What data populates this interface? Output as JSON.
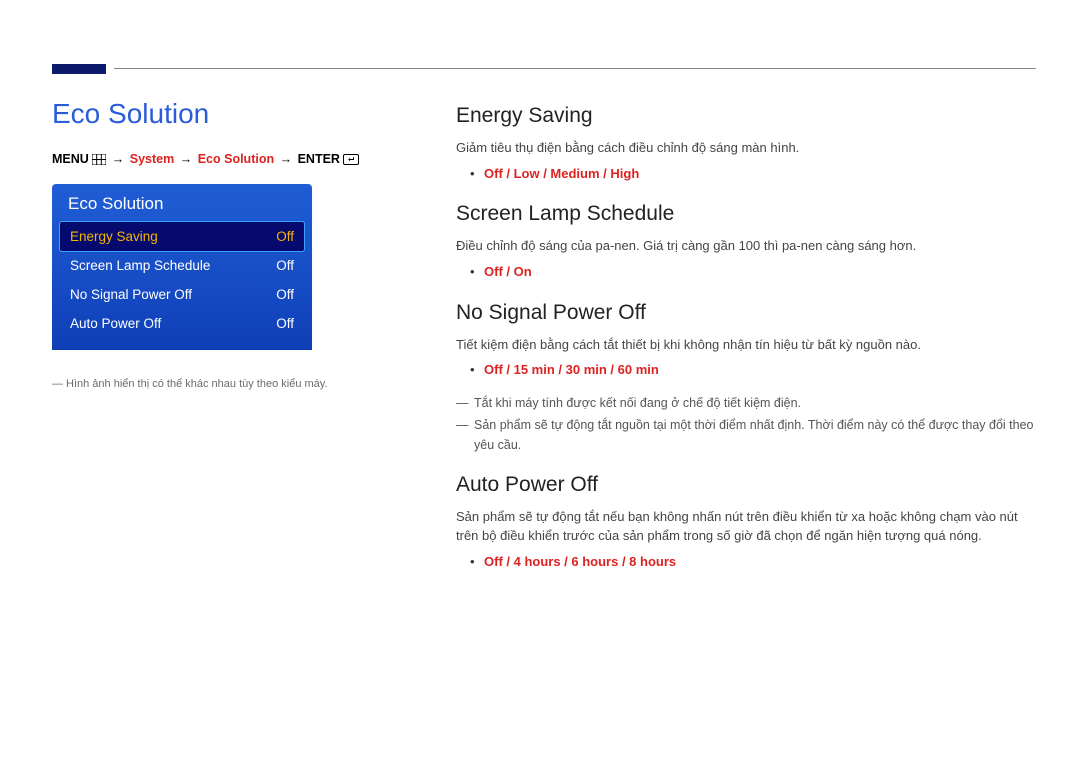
{
  "page": {
    "title": "Eco Solution"
  },
  "breadcrumb": {
    "menu": "MENU",
    "a1": "→",
    "p1": "System",
    "a2": "→",
    "p2": "Eco Solution",
    "a3": "→",
    "enter": "ENTER"
  },
  "osd": {
    "title": "Eco Solution",
    "items": [
      {
        "label": "Energy Saving",
        "value": "Off",
        "selected": true
      },
      {
        "label": "Screen Lamp Schedule",
        "value": "Off",
        "selected": false
      },
      {
        "label": "No Signal Power Off",
        "value": "Off",
        "selected": false
      },
      {
        "label": "Auto Power Off",
        "value": "Off",
        "selected": false
      }
    ]
  },
  "left_footnote": "Hình ảnh hiển thị có thể khác nhau tùy theo kiểu máy.",
  "right": {
    "energy_saving": {
      "heading": "Energy Saving",
      "desc": "Giảm tiêu thụ điện bằng cách điều chỉnh độ sáng màn hình.",
      "options": "Off / Low / Medium / High"
    },
    "screen_lamp_schedule": {
      "heading": "Screen Lamp Schedule",
      "desc": "Điều chỉnh độ sáng của pa-nen. Giá trị càng gần 100 thì pa-nen càng sáng hơn.",
      "options": "Off / On"
    },
    "no_signal_power_off": {
      "heading": "No Signal Power Off",
      "desc": "Tiết kiệm điện bằng cách tắt thiết bị khi không nhận tín hiệu từ bất kỳ nguồn nào.",
      "options": "Off / 15 min / 30 min / 60 min",
      "note1": "Tắt khi máy tính được kết nối đang ở chế độ tiết kiệm điện.",
      "note2": "Sản phẩm sẽ tự động tắt nguồn tại một thời điểm nhất định. Thời điểm này có thể được thay đổi theo yêu cầu."
    },
    "auto_power_off": {
      "heading": "Auto Power Off",
      "desc": "Sản phẩm sẽ tự động tắt nếu bạn không nhấn nút trên điều khiển từ xa hoặc không chạm vào nút trên bộ điều khiển trước của sản phẩm trong số giờ đã chọn để ngăn hiện tượng quá nóng.",
      "options": "Off / 4 hours / 6 hours / 8 hours"
    }
  }
}
